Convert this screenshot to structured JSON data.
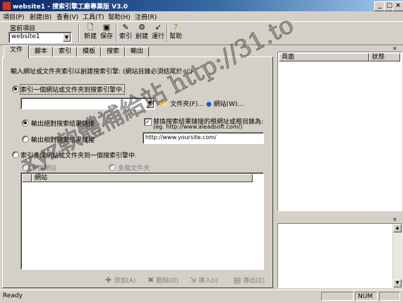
{
  "window": {
    "title": "website1 - 搜索引擎工廠專業版 V3.0"
  },
  "menu": [
    "項目(P)",
    "創建(B)",
    "查看(V)",
    "工具(T)",
    "幫助(H)",
    "注冊(R)"
  ],
  "toolbar": {
    "current_label": "當前項目",
    "project_value": "website1",
    "buttons": [
      {
        "label": "新建",
        "icon": "new-file-icon"
      },
      {
        "label": "保存",
        "icon": "save-icon"
      },
      {
        "label": "索引",
        "icon": "index-icon"
      },
      {
        "label": "創建",
        "icon": "create-icon"
      },
      {
        "label": "運行",
        "icon": "run-icon"
      },
      {
        "label": "幫助",
        "icon": "help-icon"
      }
    ]
  },
  "tabs": [
    "文件",
    "腳本",
    "索引",
    "模板",
    "搜索",
    "輸出"
  ],
  "main": {
    "instruction": "輸入網址或文件夾索引以創建搜索引擎: (網站目錄必須結尾於 '/')",
    "radio_single": "索引一個網站或文件夾到搜索引擎中.",
    "url_input_value": "",
    "folder_button": "文件夾(F)...",
    "website_button": "網站(W)...",
    "radio_absolute": "輸出絕對搜索結果鏈接",
    "radio_relative": "輸出相對搜索結果鏈接",
    "replace_check": "替換搜索結果鏈接的根網址或根目錄為:",
    "replace_example": "(eg. http://www.aleadsoft.com/)",
    "replace_value": "http://www.yoursite.com/",
    "radio_multi": "索引多個網站或文件夾到一個搜索引擎中.",
    "radio_multi_sites": "多個網站",
    "radio_multi_folders": "多個文件夾",
    "list_header": "網站",
    "buttons": {
      "add": "添加(A)",
      "delete": "刪除(D)",
      "import": "導入(I)",
      "export": "導出(E)"
    }
  },
  "right_top": {
    "col_page": "頁面",
    "col_status": "狀態"
  },
  "status": {
    "text": "Ready",
    "num": "NUM"
  },
  "watermark": "xyz軟體補給站 http://31.to"
}
